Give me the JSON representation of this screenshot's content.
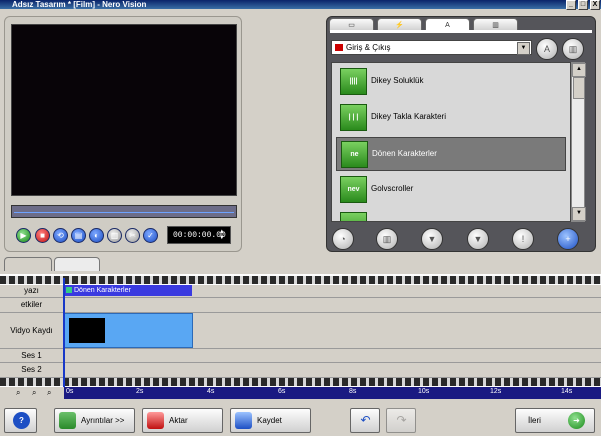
{
  "window": {
    "title": "Adsız Tasarım * [Film] - Nero Vision",
    "minimize_glyph": "_",
    "maximize_glyph": "□",
    "close_glyph": "X"
  },
  "preview": {
    "timecode": "00:00:00.00"
  },
  "effects_panel": {
    "category": "Giriş & Çıkış",
    "items": [
      {
        "label": "Dikey Soluklük",
        "thumb_text": "||||"
      },
      {
        "label": "Dikey Takla Karakteri",
        "thumb_text": "| | |"
      },
      {
        "label": "Dönen Karakterler",
        "thumb_text": "ne"
      },
      {
        "label": "Golvscroller",
        "thumb_text": "nev"
      },
      {
        "label": "",
        "thumb_text": ""
      }
    ]
  },
  "tracks": {
    "labels": [
      "yazı",
      "etkiler",
      "Vidyo Kaydı",
      "Ses 1",
      "Ses 2"
    ],
    "text_clip": "Dönen Karakterler"
  },
  "ruler": {
    "ticks": [
      "0s",
      "2s",
      "4s",
      "6s",
      "8s",
      "10s",
      "12s",
      "14s"
    ]
  },
  "buttons": {
    "details": "Ayrıntılar >>",
    "export": "Aktar",
    "save": "Kaydet",
    "next": "İleri"
  },
  "colors": {
    "accent_blue": "#1d4fc4",
    "clip_blue": "#59a7f3",
    "text_clip": "#3a3ae0",
    "ruler": "#1a1a82"
  }
}
